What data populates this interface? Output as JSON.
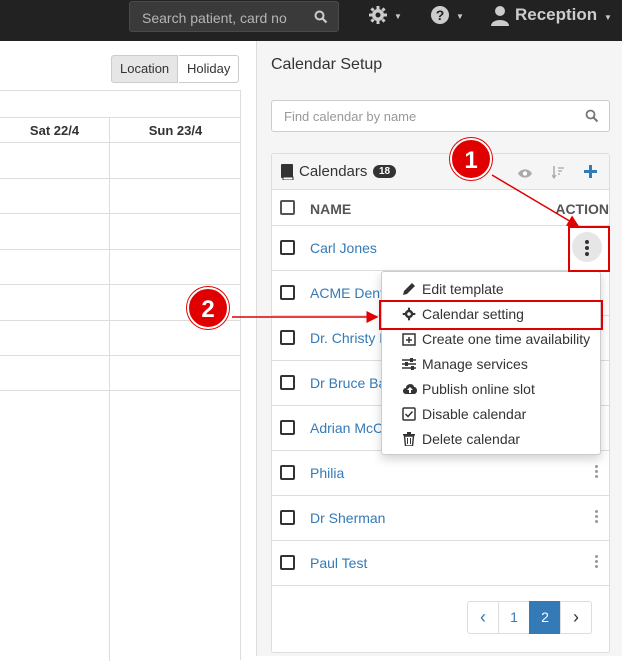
{
  "topbar": {
    "search_placeholder": "Search patient, card no",
    "user_label": "Reception"
  },
  "left": {
    "location_btn": "Location",
    "holiday_btn": "Holiday",
    "days": [
      "Sat 22/4",
      "Sun 23/4"
    ]
  },
  "right": {
    "title": "Calendar Setup",
    "find_placeholder": "Find calendar by name",
    "calendars_label": "Calendars",
    "calendars_count": "18",
    "col_name": "NAME",
    "col_action": "ACTION",
    "rows": [
      "Carl Jones",
      "ACME Dent",
      "Dr. Christy L",
      "Dr Bruce Ba",
      "Adrian McC",
      "Philia",
      "Dr Sherman",
      "Paul Test"
    ]
  },
  "menu": {
    "items": [
      "Edit template",
      "Calendar setting",
      "Create one time availability",
      "Manage services",
      "Publish online slot",
      "Disable calendar",
      "Delete calendar"
    ]
  },
  "pager": {
    "prev": "‹",
    "p1": "1",
    "p2": "2",
    "next": "›"
  },
  "annotations": {
    "step1": "1",
    "step2": "2"
  },
  "colors": {
    "accent": "#337ab7",
    "annotation": "#e00000",
    "topbar": "#222222"
  }
}
